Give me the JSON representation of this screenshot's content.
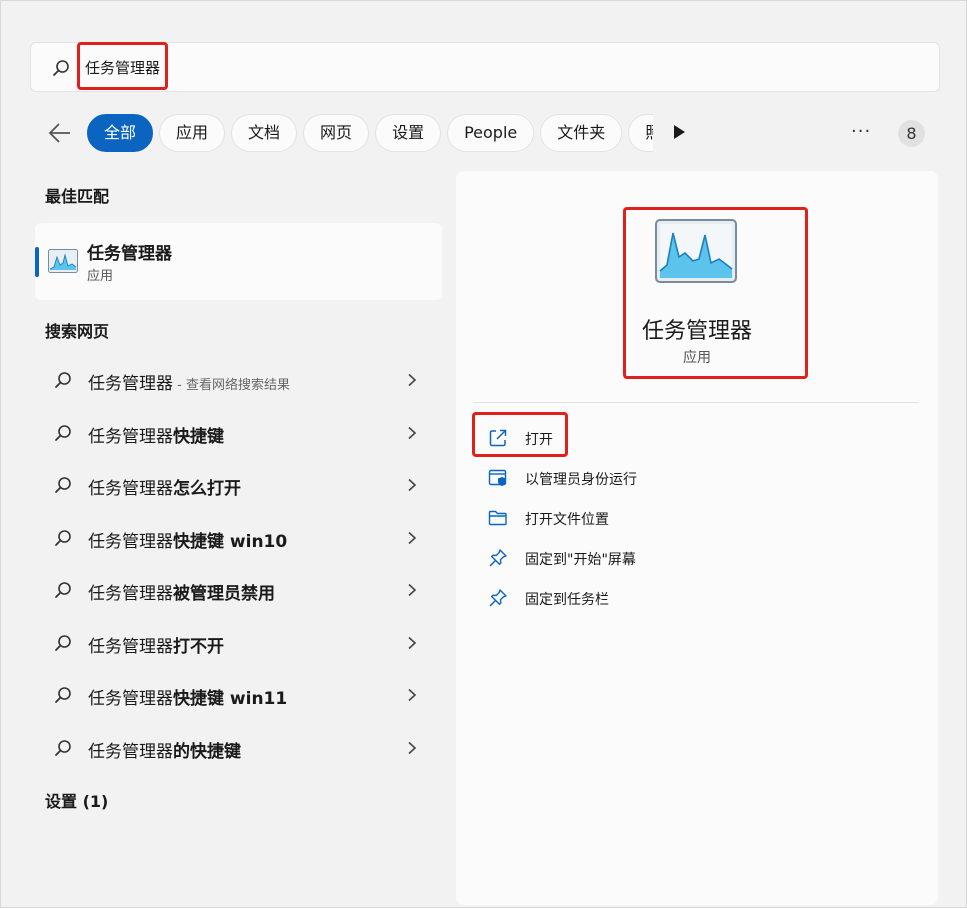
{
  "search": {
    "query": "任务管理器"
  },
  "filters": {
    "back_label": "back",
    "chips": [
      "全部",
      "应用",
      "文档",
      "网页",
      "设置",
      "People",
      "文件夹",
      "照"
    ],
    "more_label": "···",
    "badge": "8"
  },
  "best_match": {
    "heading": "最佳匹配",
    "title": "任务管理器",
    "subtitle": "应用"
  },
  "web_search": {
    "heading": "搜索网页",
    "items": [
      {
        "prefix": "任务管理器",
        "bold": "",
        "hint": " - 查看网络搜索结果"
      },
      {
        "prefix": "任务管理器",
        "bold": "快捷键",
        "hint": ""
      },
      {
        "prefix": "任务管理器",
        "bold": "怎么打开",
        "hint": ""
      },
      {
        "prefix": "任务管理器",
        "bold": "快捷键 win10",
        "hint": ""
      },
      {
        "prefix": "任务管理器",
        "bold": "被管理员禁用",
        "hint": ""
      },
      {
        "prefix": "任务管理器",
        "bold": "打不开",
        "hint": ""
      },
      {
        "prefix": "任务管理器",
        "bold": "快捷键 win11",
        "hint": ""
      },
      {
        "prefix": "任务管理器",
        "bold": "的快捷键",
        "hint": ""
      }
    ]
  },
  "settings": {
    "heading": "设置 (1)"
  },
  "detail": {
    "app_name": "任务管理器",
    "app_type": "应用",
    "actions": [
      {
        "icon": "open-external-icon",
        "label": "打开"
      },
      {
        "icon": "run-as-admin-icon",
        "label": "以管理员身份运行"
      },
      {
        "icon": "folder-icon",
        "label": "打开文件位置"
      },
      {
        "icon": "pin-icon",
        "label": "固定到\"开始\"屏幕"
      },
      {
        "icon": "pin-icon",
        "label": "固定到任务栏"
      }
    ]
  },
  "colors": {
    "accent": "#0b64c0",
    "highlight": "#e0201c"
  }
}
